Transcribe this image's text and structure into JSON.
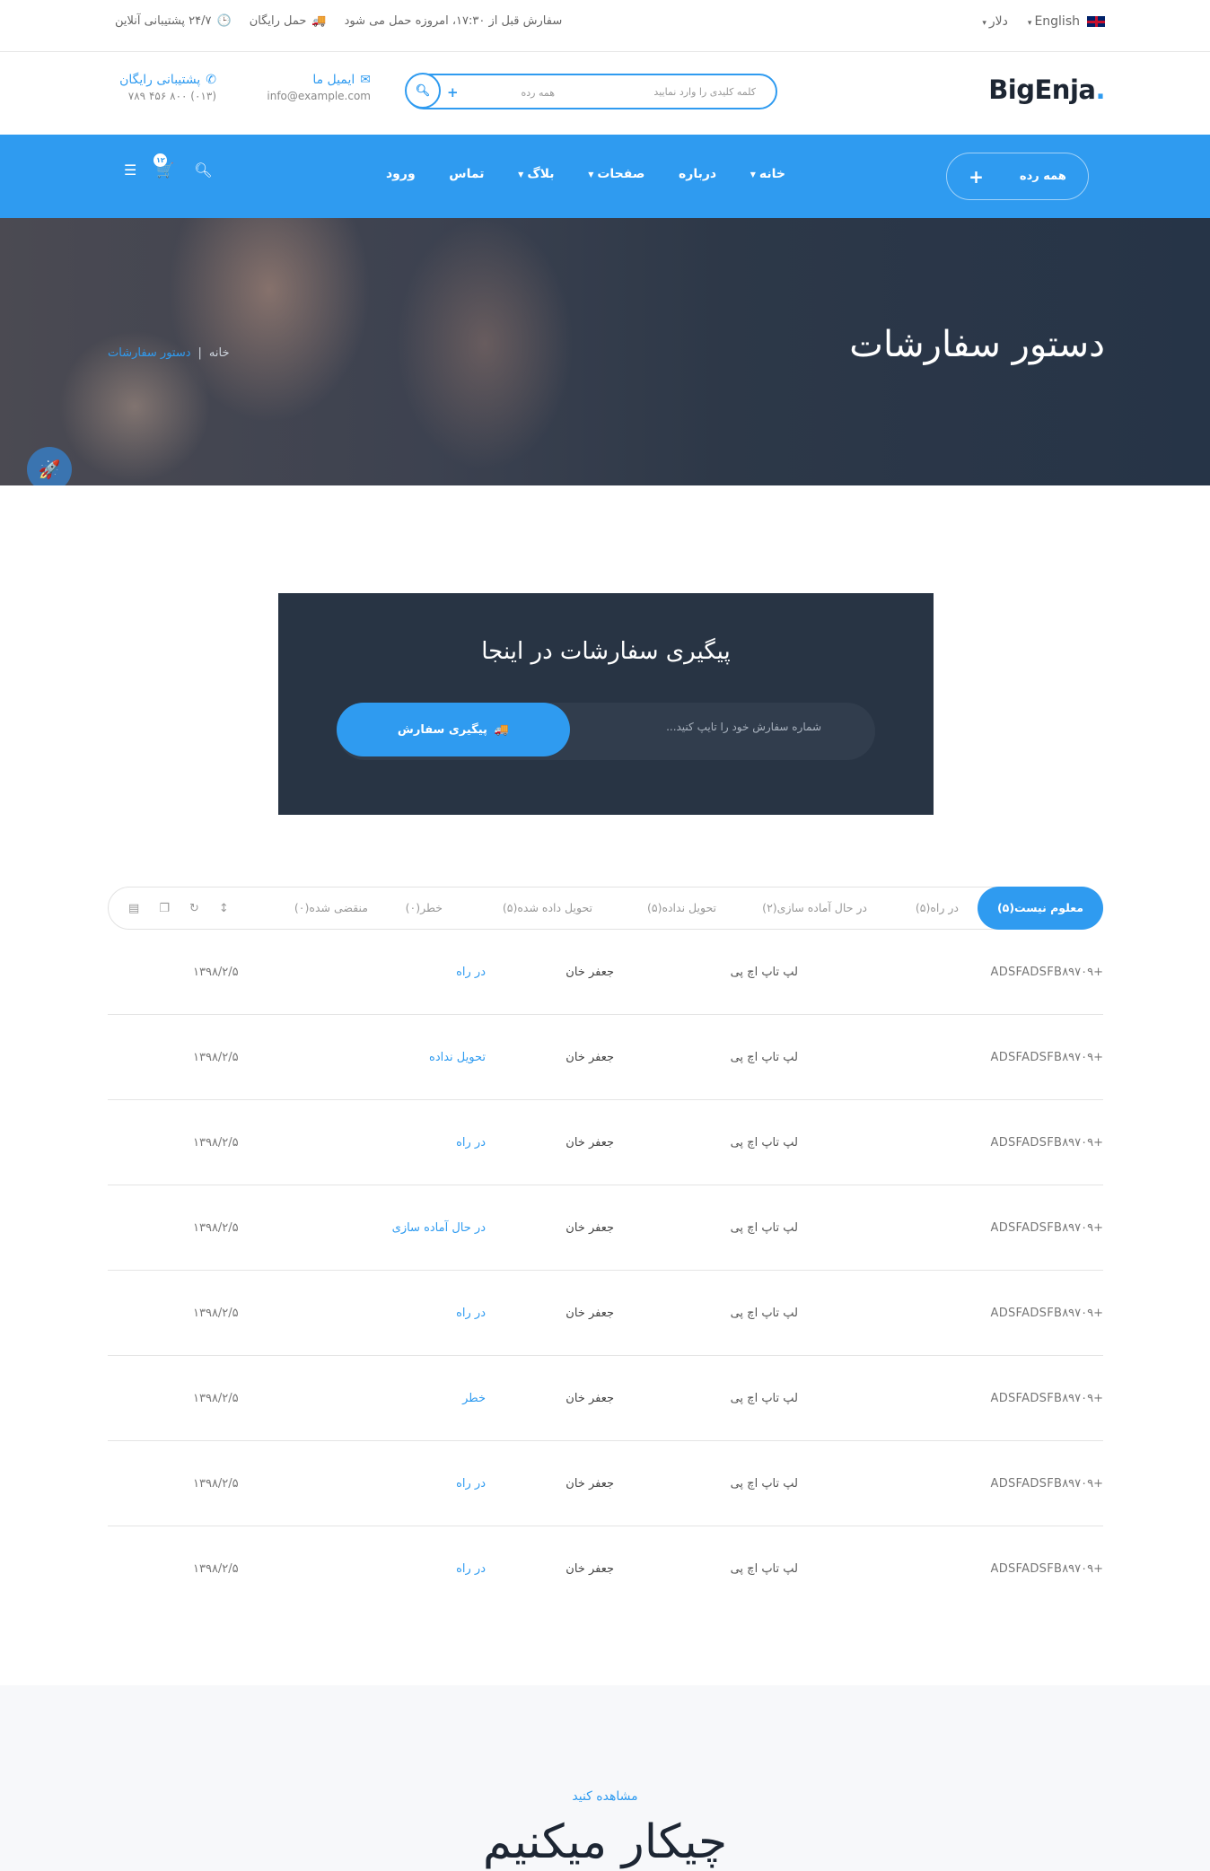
{
  "topbar": {
    "language": "English",
    "currency": "دلار",
    "order_notice": "سفارش قبل از ۱۷:۳۰، امروزه حمل می شود",
    "free_shipping": "حمل رایگان",
    "online_support": "۲۴/۷ پشتیبانی آنلاین"
  },
  "header": {
    "logo": "BigEnja",
    "logo_dot": ".",
    "search_placeholder": "کلمه کلیدی را وارد نمایید",
    "search_category": "همه رده",
    "email_title": "ایمیل ما",
    "email_value": "info@example.com",
    "phone_title": "پشتیبانی رایگان",
    "phone_value": "(۰۱۳) ۸۰۰ ۴۵۶ ۷۸۹"
  },
  "nav": {
    "categories_label": "همه رده",
    "items": [
      "خانه",
      "درباره",
      "صفحات",
      "بلاگ",
      "تماس",
      "ورود"
    ],
    "cart_count": "۱۲"
  },
  "hero": {
    "title": "دستور سفارشات",
    "breadcrumb_home": "خانه",
    "breadcrumb_sep": "|",
    "breadcrumb_current": "دستور سفارشات"
  },
  "tracking": {
    "title": "پیگیری سفارشات در اینجا",
    "input_placeholder": "شماره سفارش خود را تایپ کنید...",
    "button_label": "پیگیری سفارش"
  },
  "tabs": [
    "معلوم نیست(۵)",
    "در راه(۵)",
    "در حال آماده سازی(۲)",
    "تحویل نداده(۵)",
    "تحویل داده شده(۵)",
    "خطر(۰)",
    "منقضی شده(۰)"
  ],
  "orders": [
    {
      "code": "ADSFADSFB۸۹۷۰۹+",
      "product": "لپ تاپ اچ پی",
      "customer": "جعفر خان",
      "status": "در راه",
      "date": "۱۳۹۸/۲/۵"
    },
    {
      "code": "ADSFADSFB۸۹۷۰۹+",
      "product": "لپ تاپ اچ پی",
      "customer": "جعفر خان",
      "status": "تحویل نداده",
      "date": "۱۳۹۸/۲/۵"
    },
    {
      "code": "ADSFADSFB۸۹۷۰۹+",
      "product": "لپ تاپ اچ پی",
      "customer": "جعفر خان",
      "status": "در راه",
      "date": "۱۳۹۸/۲/۵"
    },
    {
      "code": "ADSFADSFB۸۹۷۰۹+",
      "product": "لپ تاپ اچ پی",
      "customer": "جعفر خان",
      "status": "در حال آماده سازی",
      "date": "۱۳۹۸/۲/۵"
    },
    {
      "code": "ADSFADSFB۸۹۷۰۹+",
      "product": "لپ تاپ اچ پی",
      "customer": "جعفر خان",
      "status": "در راه",
      "date": "۱۳۹۸/۲/۵"
    },
    {
      "code": "ADSFADSFB۸۹۷۰۹+",
      "product": "لپ تاپ اچ پی",
      "customer": "جعفر خان",
      "status": "خطر",
      "date": "۱۳۹۸/۲/۵"
    },
    {
      "code": "ADSFADSFB۸۹۷۰۹+",
      "product": "لپ تاپ اچ پی",
      "customer": "جعفر خان",
      "status": "در راه",
      "date": "۱۳۹۸/۲/۵"
    },
    {
      "code": "ADSFADSFB۸۹۷۰۹+",
      "product": "لپ تاپ اچ پی",
      "customer": "جعفر خان",
      "status": "در راه",
      "date": "۱۳۹۸/۲/۵"
    }
  ],
  "what_we_do": {
    "subtitle": "مشاهده کنید",
    "title": "چیکار میکنیم"
  },
  "colors": {
    "accent": "#2f9bf0",
    "dark_panel": "#283444"
  },
  "icons": [
    "uk-flag-icon",
    "clock-icon",
    "truck-icon",
    "search-icon",
    "envelope-icon",
    "phone-icon",
    "cart-icon",
    "menu-icon",
    "rocket-icon",
    "copy-icon",
    "refresh-icon",
    "sort-icon"
  ]
}
